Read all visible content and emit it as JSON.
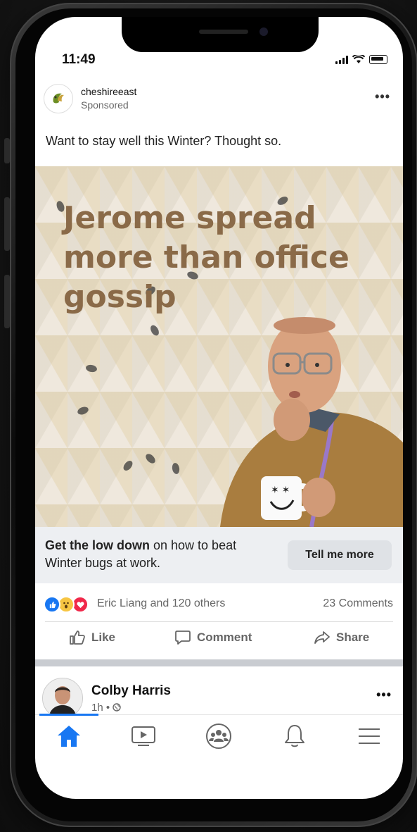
{
  "status_bar": {
    "time": "11:49"
  },
  "post": {
    "page_name": "cheshireeast",
    "sponsored_label": "Sponsored",
    "more_label": "•••",
    "text": "Want to stay well this Winter? Thought so.",
    "ad_headline": "Jerome spread more than office gossip",
    "cta": {
      "bold": "Get the low down",
      "rest": " on how to beat Winter bugs at work.",
      "button": "Tell me more"
    },
    "reactions_text": "Eric Liang and 120 others",
    "comments_count": "23 Comments",
    "actions": {
      "like": "Like",
      "comment": "Comment",
      "share": "Share"
    }
  },
  "next_post": {
    "user_name": "Colby Harris",
    "meta": "1h • ",
    "more_label": "•••"
  },
  "colors": {
    "accent": "#1877f2",
    "headline": "#8a6a48",
    "cta_bar": "#edeff2"
  },
  "bottom_nav": [
    "home-icon",
    "video-icon",
    "groups-icon",
    "bell-icon",
    "menu-icon"
  ]
}
